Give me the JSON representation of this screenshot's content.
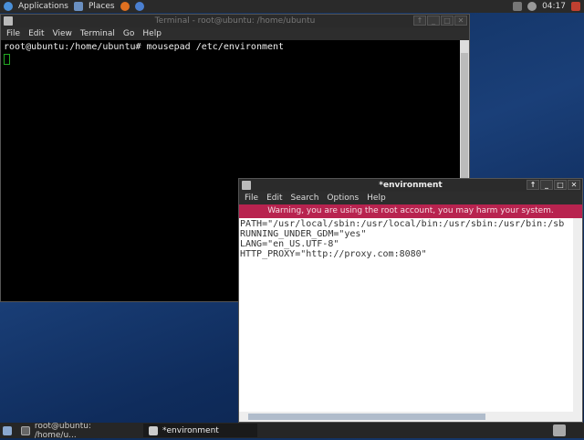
{
  "top_panel": {
    "applications": "Applications",
    "places": "Places",
    "clock": "04:17",
    "icons": [
      "distro-logo-icon",
      "places-folder-icon",
      "firefox-icon",
      "help-icon",
      "network-icon",
      "volume-icon",
      "user-icon"
    ]
  },
  "terminal": {
    "title": "Terminal - root@ubuntu: /home/ubuntu",
    "menu": [
      "File",
      "Edit",
      "View",
      "Terminal",
      "Go",
      "Help"
    ],
    "lines": [
      "root@ubuntu:/home/ubuntu# mousepad /etc/environment"
    ],
    "buttons": [
      "↑",
      "_",
      "□",
      "✕"
    ]
  },
  "editor": {
    "title": "*environment",
    "menu": [
      "File",
      "Edit",
      "Search",
      "Options",
      "Help"
    ],
    "warning": "Warning, you are using the root account, you may harm your system.",
    "warning_color": "#b8234f",
    "lines": [
      "PATH=\"/usr/local/sbin:/usr/local/bin:/usr/sbin:/usr/bin:/sb",
      "RUNNING_UNDER_GDM=\"yes\"",
      "LANG=\"en_US.UTF-8\"",
      "HTTP_PROXY=\"http://proxy.com:8080\""
    ],
    "buttons": [
      "↑",
      "_",
      "□",
      "✕"
    ]
  },
  "taskbar": {
    "items": [
      "root@ubuntu: /home/u...",
      "*environment"
    ]
  }
}
